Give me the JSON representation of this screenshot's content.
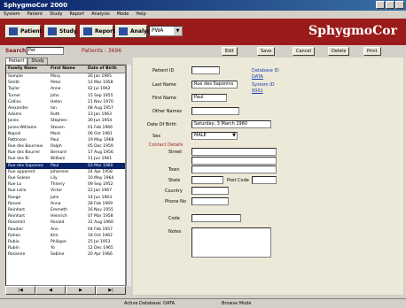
{
  "window": {
    "title": "SphygmoCor 2000"
  },
  "menu": [
    "System",
    "Patient",
    "Study",
    "Report",
    "Analysis",
    "Mode",
    "Help"
  ],
  "toolbar": {
    "buttons": [
      "Patient",
      "Study",
      "Report",
      "Analysis"
    ],
    "mode_value": "PWA",
    "brand": "SphygmoCor"
  },
  "search": {
    "label": "Search",
    "value": "Pat",
    "patients_label": "Patients :",
    "patients_count": "3696",
    "actions": [
      "Edit",
      "Save",
      "Cancel",
      "Delete",
      "Print"
    ]
  },
  "list": {
    "tabs": [
      "Patient",
      "Study"
    ],
    "headers": [
      "Family Name",
      "First Name",
      "Date of Birth"
    ],
    "rows": [
      [
        "Sample",
        "Mary",
        "26 Jan 1965"
      ],
      [
        "Smith",
        "Peter",
        "12 Mar 1958"
      ],
      [
        "Taylor",
        "Anne",
        "02 Jul 1962"
      ],
      [
        "Turner",
        "John",
        "15 Sep 1955"
      ],
      [
        "Collins",
        "Helen",
        "21 Nov 1970"
      ],
      [
        "Alexander",
        "Ian",
        "08 Aug 1957"
      ],
      [
        "Adams",
        "Ruth",
        "13 Jan 1963"
      ],
      [
        "Jones",
        "Stephen",
        "30 Jun 1954"
      ],
      [
        "Jones-Williams",
        "Steven",
        "01 Feb 1966"
      ],
      [
        "Napoli",
        "Mark",
        "06 Oct 1961"
      ],
      [
        "Pattinson",
        "Paul",
        "19 May 1968"
      ],
      [
        "Rue des Bourneix",
        "Ralph",
        "05 Dec 1959"
      ],
      [
        "Rue des Bourrel",
        "Bernard",
        "17 Aug 1956"
      ],
      [
        "Rue des Bi",
        "William",
        "11 Jun 1961"
      ],
      [
        "Rue des Saponins",
        "Paul",
        "03 Mar 1960"
      ],
      [
        "Rue apparent",
        "Johannes",
        "24 Apr 1958"
      ],
      [
        "Rue Soleon",
        "Lily",
        "10 May 1964"
      ],
      [
        "Rue Lo",
        "Thierry",
        "09 Sep 1952"
      ],
      [
        "Rue Leila",
        "Victor",
        "22 Jan 1967"
      ],
      [
        "Range",
        "Julie",
        "14 Jun 1963"
      ],
      [
        "Rosser",
        "Anna",
        "28 Feb 1969"
      ],
      [
        "Reinhart",
        "Emmeth",
        "16 Nov 1955"
      ],
      [
        "Reinhart",
        "Heinrich",
        "07 Mar 1958"
      ],
      [
        "Rosemill",
        "Ronald",
        "31 Aug 1960"
      ],
      [
        "Roudier",
        "Ann",
        "04 Feb 1957"
      ],
      [
        "Rahen",
        "Kim",
        "18 Oct 1962"
      ],
      [
        "Rubio",
        "Philippe",
        "25 Jul 1953"
      ],
      [
        "Rubin",
        "Yo",
        "12 Dec 1965"
      ],
      [
        "Rosanne",
        "Sabine",
        "20 Apr 1966"
      ]
    ],
    "selected_index": 14,
    "nav": [
      "|◀",
      "◀",
      "▶",
      "▶|"
    ]
  },
  "form": {
    "patient_id_label": "Patient ID",
    "patient_id": "",
    "last_name_label": "Last Name",
    "last_name": "Rue des Saponins",
    "first_name_label": "First Name",
    "first_name": "Paul",
    "other_names_label": "Other Names",
    "other_names": "",
    "dob_label": "Date Of Birth",
    "dob_day": "Saturday",
    "dob_date": "3",
    "dob_month": "March",
    "dob_year": "1960",
    "sex_label": "Sex",
    "sex": "MALE",
    "contact_label": "Contact Details",
    "street_label": "Street",
    "town_label": "Town",
    "state_label": "State",
    "postcode_label": "Post Code",
    "country_label": "Country",
    "phone_label": "Phone No",
    "code_label": "Code",
    "notes_label": "Notes",
    "database_label": "Database ID",
    "database_value": "DATA",
    "system_label": "System ID",
    "system_value": "0001"
  },
  "status": {
    "active_db": "Active Database:  DATA",
    "mode": "Browse Mode"
  }
}
